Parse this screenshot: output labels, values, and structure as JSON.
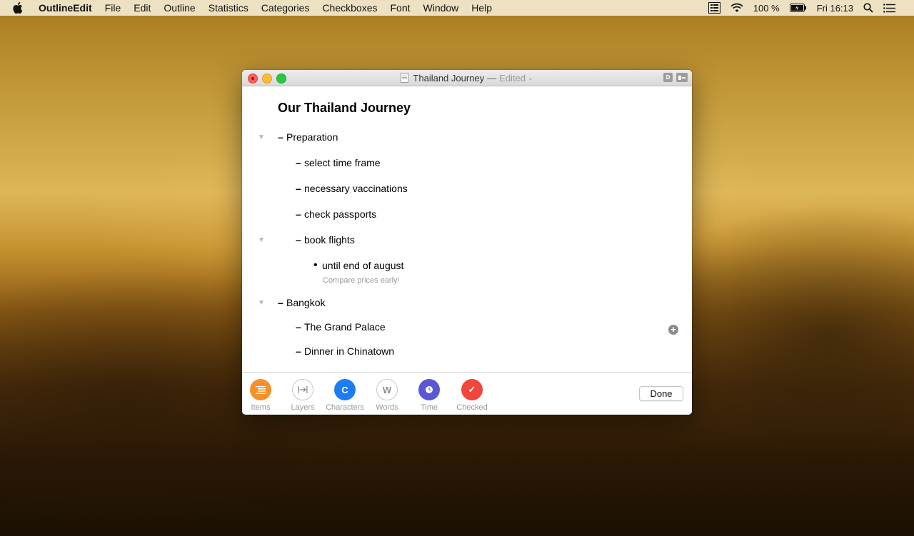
{
  "menubar": {
    "app_name": "OutlineEdit",
    "items": [
      "File",
      "Edit",
      "Outline",
      "Statistics",
      "Categories",
      "Checkboxes",
      "Font",
      "Window",
      "Help"
    ],
    "battery": "100 %",
    "clock": "Fri 16:13"
  },
  "window": {
    "title": "Thailand Journey",
    "separator": "—",
    "status": "Edited",
    "tb_btn_1": "D"
  },
  "document": {
    "title": "Our Thailand Journey",
    "items": [
      {
        "text": "Preparation",
        "level": 0,
        "bullet": "dash",
        "collapsible": true
      },
      {
        "text": "select time frame",
        "level": 1,
        "bullet": "dash"
      },
      {
        "text": "necessary vaccinations",
        "level": 1,
        "bullet": "dash"
      },
      {
        "text": "check passports",
        "level": 1,
        "bullet": "dash"
      },
      {
        "text": "book flights",
        "level": 1,
        "bullet": "dash",
        "collapsible": true
      },
      {
        "text": "until end of august",
        "level": 2,
        "bullet": "dot",
        "note": "Compare prices early!"
      },
      {
        "text": "Bangkok",
        "level": 0,
        "bullet": "dash",
        "collapsible": true
      },
      {
        "text": "The Grand Palace",
        "level": 1,
        "bullet": "dash"
      },
      {
        "text": "Dinner in Chinatown",
        "level": 1,
        "bullet": "dash"
      }
    ]
  },
  "stats": [
    {
      "label": "Items",
      "icon": "list-icon",
      "color": "#f7902a"
    },
    {
      "label": "Layers",
      "icon": "layers-icon",
      "color": "#ffffff"
    },
    {
      "label": "Characters",
      "icon_text": "C",
      "color": "#1e7cf2"
    },
    {
      "label": "Words",
      "icon_text": "W",
      "color": "#ffffff"
    },
    {
      "label": "Time",
      "icon": "clock-icon",
      "color": "#5a57d6"
    },
    {
      "label": "Checked",
      "icon": "check-icon",
      "color": "#f2453b"
    }
  ],
  "done_label": "Done"
}
